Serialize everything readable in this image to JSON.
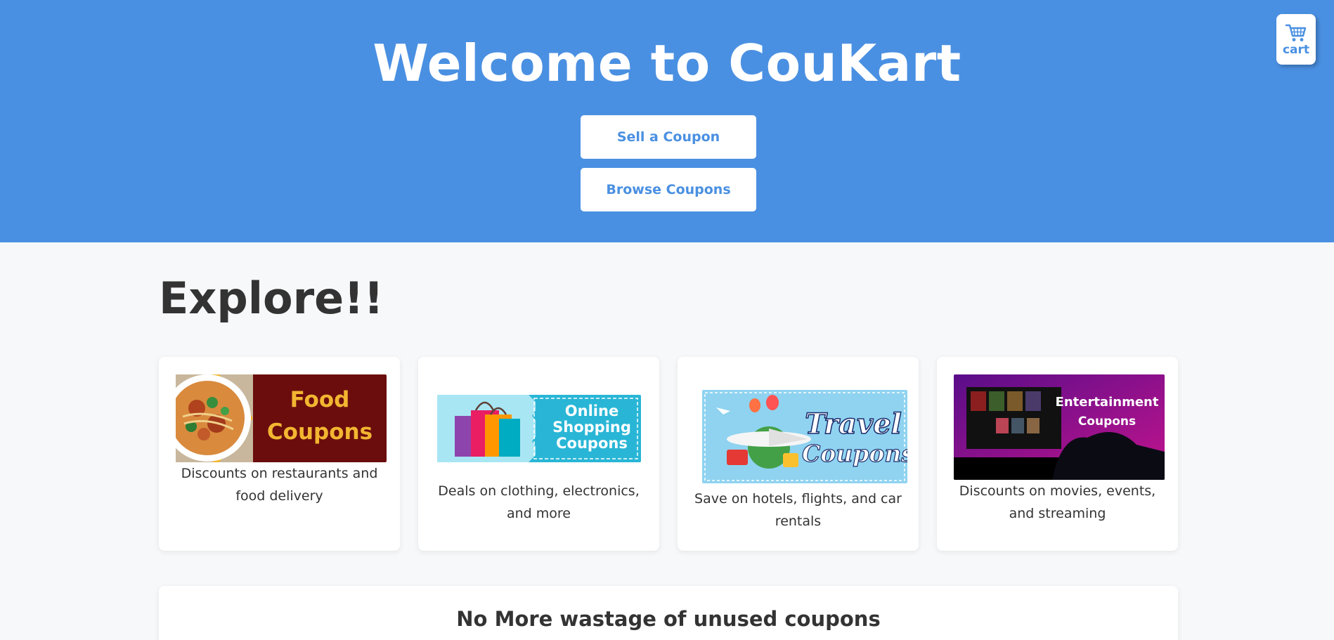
{
  "header": {
    "title": "Welcome to CouKart",
    "sell_label": "Sell a Coupon",
    "browse_label": "Browse Coupons",
    "cart_label": "cart",
    "cart_icon": "shopping-cart-icon"
  },
  "explore": {
    "title": "Explore!!",
    "categories": [
      {
        "image_text": [
          "Food",
          "Coupons"
        ],
        "description": "Discounts on restaurants and food delivery"
      },
      {
        "image_text": [
          "Online",
          "Shopping",
          "Coupons"
        ],
        "description": "Deals on clothing, electronics, and more"
      },
      {
        "image_text": [
          "Travel",
          "Coupons"
        ],
        "description": "Save on hotels, flights, and car rentals"
      },
      {
        "image_text": [
          "Entertainment",
          "Coupons"
        ],
        "description": "Discounts on movies, events, and streaming"
      }
    ]
  },
  "banner": {
    "text": "No More wastage of unused coupons"
  },
  "colors": {
    "primary": "#4a90e2",
    "background": "#f7f8fa",
    "text": "#333333"
  }
}
